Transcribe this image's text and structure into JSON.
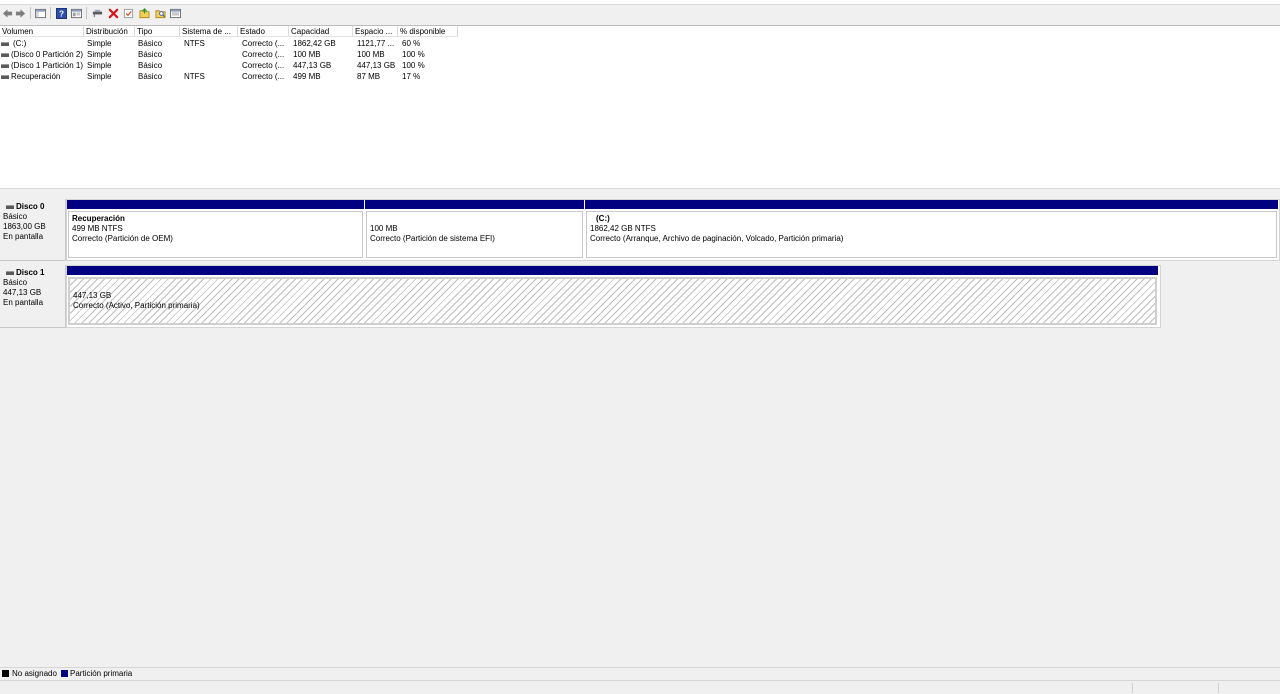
{
  "toolbar": {
    "icons": [
      "back-arrow-icon",
      "forward-arrow-icon",
      "console-tree-icon",
      "help-icon",
      "properties-icon",
      "connect-icon",
      "delete-icon",
      "check-icon",
      "folder-icon",
      "search-folder-icon",
      "details-icon"
    ]
  },
  "volumes": {
    "columns": [
      "Volumen",
      "Distribución",
      "Tipo",
      "Sistema de ...",
      "Estado",
      "Capacidad",
      "Espacio ...",
      "% disponible"
    ],
    "rows": [
      [
        "(C:)",
        "Simple",
        "Básico",
        "NTFS",
        "Correcto (...",
        "1862,42 GB",
        "1121,77 ...",
        "60 %"
      ],
      [
        "(Disco 0 Partición 2)",
        "Simple",
        "Básico",
        "",
        "Correcto (...",
        "100 MB",
        "100 MB",
        "100 %"
      ],
      [
        "(Disco 1 Partición 1)",
        "Simple",
        "Básico",
        "",
        "Correcto (...",
        "447,13 GB",
        "447,13 GB",
        "100 %"
      ],
      [
        "Recuperación",
        "Simple",
        "Básico",
        "NTFS",
        "Correcto (...",
        "499 MB",
        "87 MB",
        "17 %"
      ]
    ]
  },
  "disks": [
    {
      "name": "Disco 0",
      "type": "Básico",
      "size": "1863,00 GB",
      "status": "En pantalla",
      "partitions": [
        {
          "name": "Recuperación",
          "size": "499 MB NTFS",
          "status": "Correcto (Partición de OEM)"
        },
        {
          "name": "",
          "size": "100 MB",
          "status": "Correcto (Partición de sistema EFI)"
        },
        {
          "name": "(C:)",
          "size": "1862,42 GB NTFS",
          "status": "Correcto (Arranque, Archivo de paginación, Volcado, Partición primaria)"
        }
      ]
    },
    {
      "name": "Disco 1",
      "type": "Básico",
      "size": "447,13 GB",
      "status": "En pantalla",
      "partitions": [
        {
          "name": "",
          "size": "447,13 GB",
          "status": "Correcto (Activo, Partición primaria)"
        }
      ]
    }
  ],
  "legend": {
    "unallocated": {
      "label": "No asignado",
      "color": "#000000"
    },
    "primary": {
      "label": "Partición primaria",
      "color": "#000080"
    }
  }
}
